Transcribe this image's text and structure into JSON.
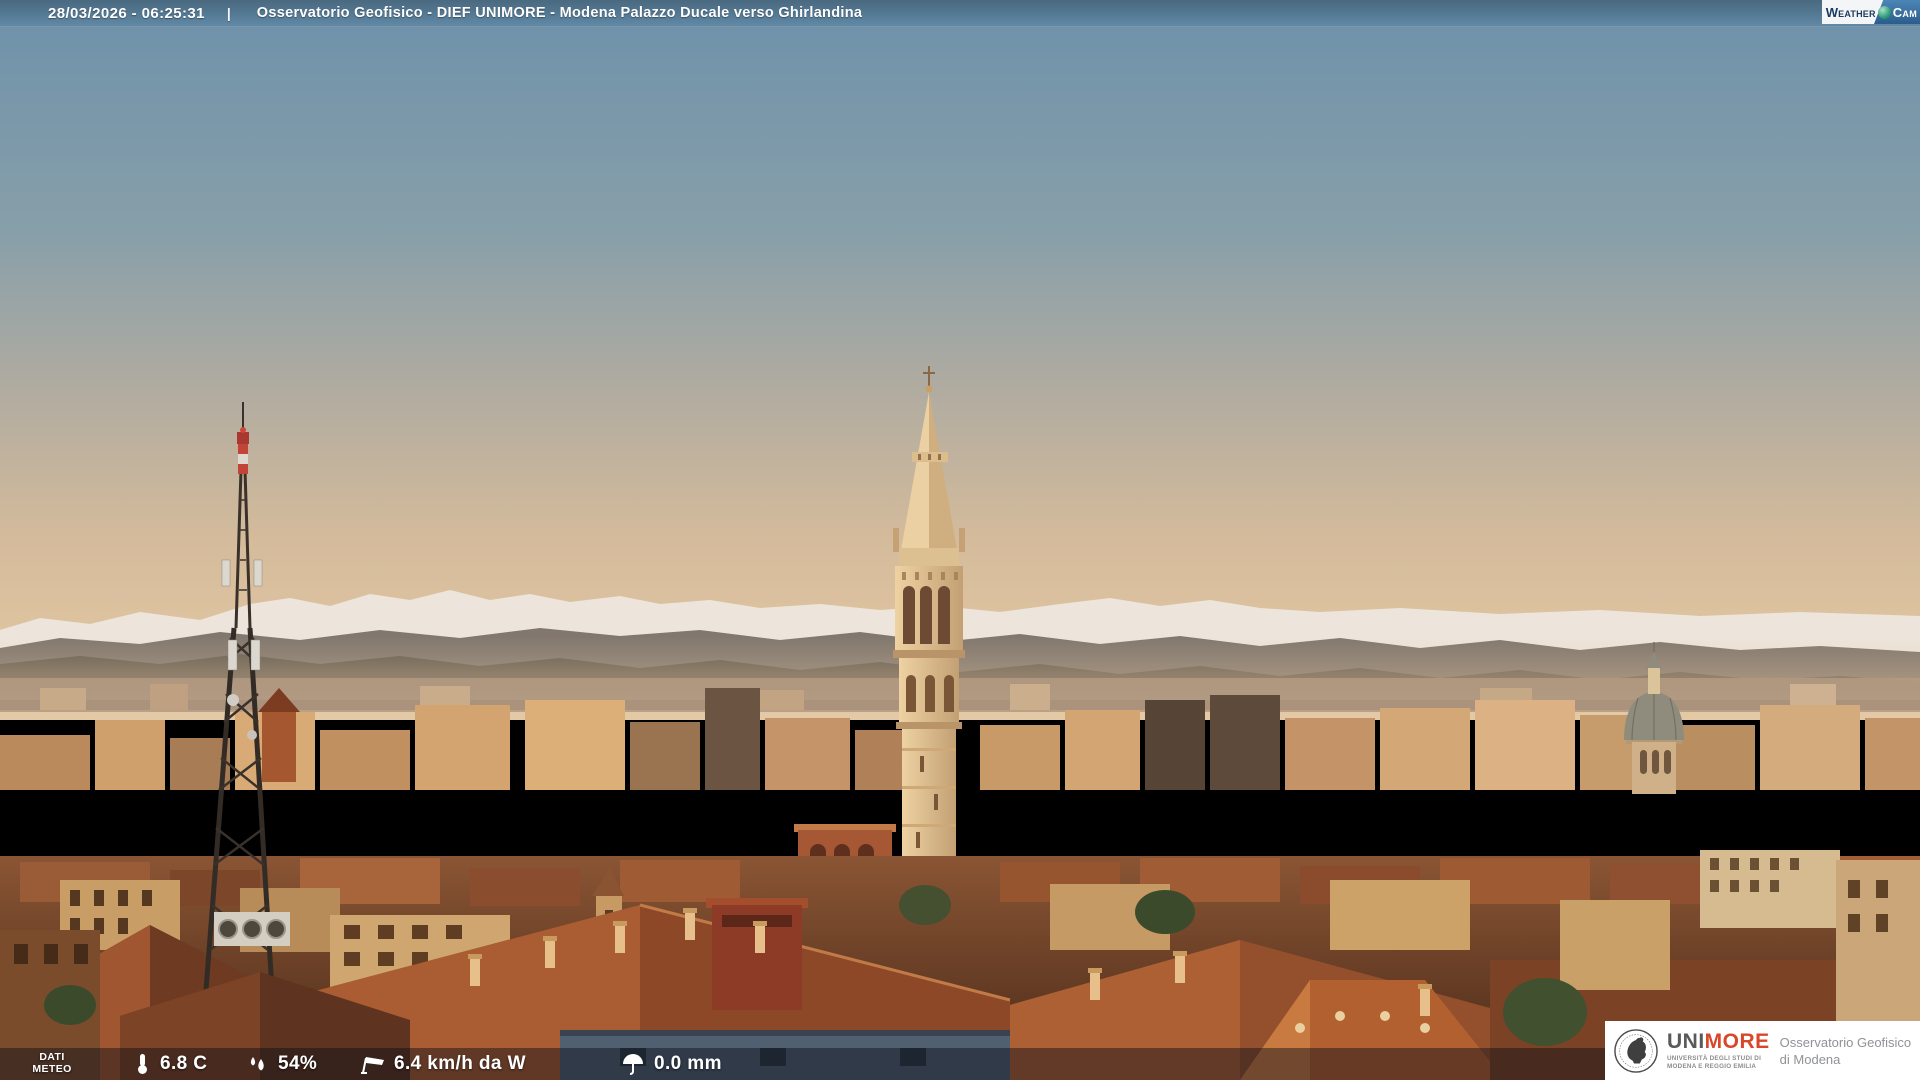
{
  "top_bar": {
    "datetime": "28/03/2026 - 06:25:31",
    "separator": "|",
    "title": "Osservatorio Geofisico - DIEF UNIMORE - Modena Palazzo Ducale verso Ghirlandina"
  },
  "weathercam": {
    "weather": "Weather",
    "cam": "Cam"
  },
  "bottom_bar": {
    "label": {
      "line1": "DATI",
      "line2": "METEO"
    },
    "readings": [
      {
        "icon": "thermometer-icon",
        "value": "6.8 C"
      },
      {
        "icon": "humidity-icon",
        "value": "54%"
      },
      {
        "icon": "wind-icon",
        "value": "6.4 km/h da W"
      },
      {
        "icon": "rain-icon",
        "value": "0.0 mm"
      }
    ]
  },
  "unimore_box": {
    "brand_uni": "UNI",
    "brand_more": "MORE",
    "subtitle1": "UNIVERSITÀ DEGLI STUDI DI",
    "subtitle2": "MODENA E REGGIO EMILIA",
    "observatory_line1": "Osservatorio Geofisico",
    "observatory_line2": "di Modena"
  },
  "colors": {
    "top_bar_top": "#49697f",
    "top_bar_bottom": "#6189a6",
    "weathercam_navy": "#1a3a5e",
    "weathercam_blue": "#2c5d8c",
    "weathercam_green": "#2f9e7a",
    "unimore_red": "#d9472b",
    "unimore_gray": "#5a5a5c",
    "bottom_bar_overlay": "rgba(9,14,24,0.45)",
    "sky_top": "#6d91ab",
    "sky_horizon": "#e2c7a2"
  }
}
